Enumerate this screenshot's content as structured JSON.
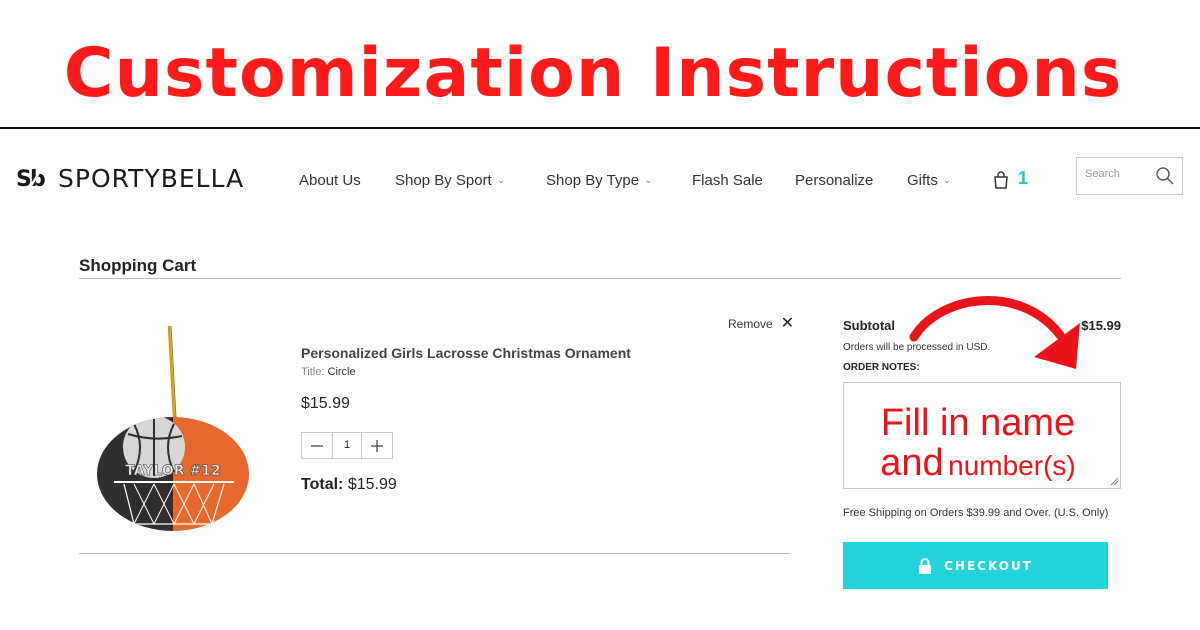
{
  "banner": {
    "title": "Customization Instructions"
  },
  "header": {
    "logo_text": "SPORTYBELLA",
    "nav": [
      {
        "label": "About Us",
        "has_dropdown": false
      },
      {
        "label": "Shop By Sport",
        "has_dropdown": true
      },
      {
        "label": "Shop By Type",
        "has_dropdown": true
      },
      {
        "label": "Flash Sale",
        "has_dropdown": false
      },
      {
        "label": "Personalize",
        "has_dropdown": false
      },
      {
        "label": "Gifts",
        "has_dropdown": true
      }
    ],
    "cart_count": "1",
    "search_placeholder": "Search"
  },
  "cart": {
    "heading": "Shopping Cart",
    "item": {
      "remove_label": "Remove",
      "image_text": "TAYLOR  #12",
      "name": "Personalized Girls Lacrosse Christmas Ornament",
      "variant_key": "Title:",
      "variant_value": "Circle",
      "price": "$15.99",
      "quantity": "1",
      "total_label": "Total:",
      "total_value": "$15.99"
    }
  },
  "summary": {
    "subtotal_label": "Subtotal",
    "subtotal_value": "$15.99",
    "usd_note": "Orders will be processed in USD.",
    "notes_label": "ORDER NOTES:",
    "notes_line1": "Fill in name",
    "notes_line2_a": "and",
    "notes_line2_b": "number(s)",
    "shipping_note": "Free Shipping on Orders $39.99 and Over. (U.S. Only)",
    "checkout_label": "CHECKOUT"
  },
  "colors": {
    "banner_red": "#ff1a1a",
    "accent_teal": "#22d3d9",
    "cart_count_teal": "#22c3cf",
    "annotation_red": "#e8141a",
    "ornament_orange": "#e8692e",
    "ornament_dark": "#2f2f2f"
  },
  "icons": {
    "cart": "shopping-bag-icon",
    "search": "magnifier-icon",
    "remove": "close-icon",
    "checkout": "lock-icon",
    "dropdown": "chevron-down-icon"
  }
}
